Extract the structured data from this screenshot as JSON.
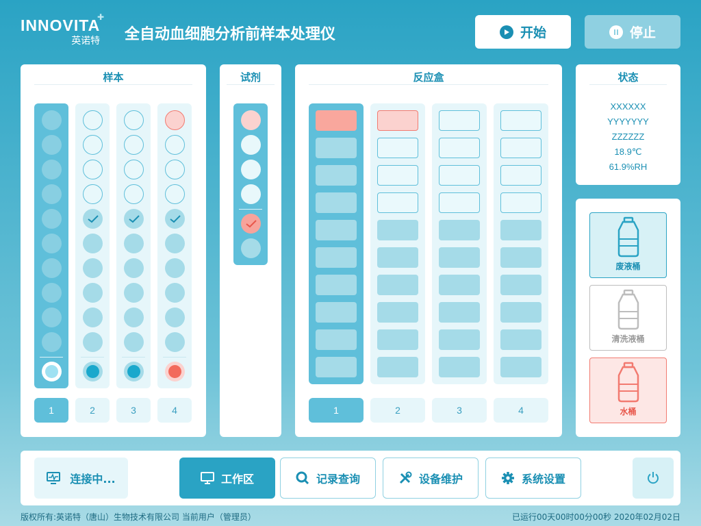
{
  "header": {
    "logo_text": "INNOVITA",
    "logo_sub": "英诺特",
    "title": "全自动血细胞分析前样本处理仪",
    "start_label": "开始",
    "stop_label": "停止"
  },
  "sample_panel": {
    "title": "样本",
    "columns": [
      "1",
      "2",
      "3",
      "4"
    ]
  },
  "reagent_panel": {
    "title": "试剂"
  },
  "reaction_panel": {
    "title": "反应盒",
    "columns": [
      "1",
      "2",
      "3",
      "4"
    ]
  },
  "status_panel": {
    "title": "状态",
    "lines": [
      "XXXXXX",
      "YYYYYYY",
      "ZZZZZZ",
      "18.9℃",
      "61.9%RH"
    ]
  },
  "buckets": {
    "waste": "废液桶",
    "clean": "清洗液桶",
    "water": "水桶"
  },
  "nav": {
    "connection": "连接中...",
    "workspace": "工作区",
    "records": "记录查询",
    "maintenance": "设备维护",
    "settings": "系统设置"
  },
  "footer": {
    "left": "版权所有:英诺特（唐山）生物技术有限公司  当前用户（管理员）",
    "right": "已运行00天00时00分00秒   2020年02月02日"
  },
  "colors": {
    "primary": "#2aa3c4",
    "accent": "#5fbfda",
    "alert": "#f27a70"
  }
}
